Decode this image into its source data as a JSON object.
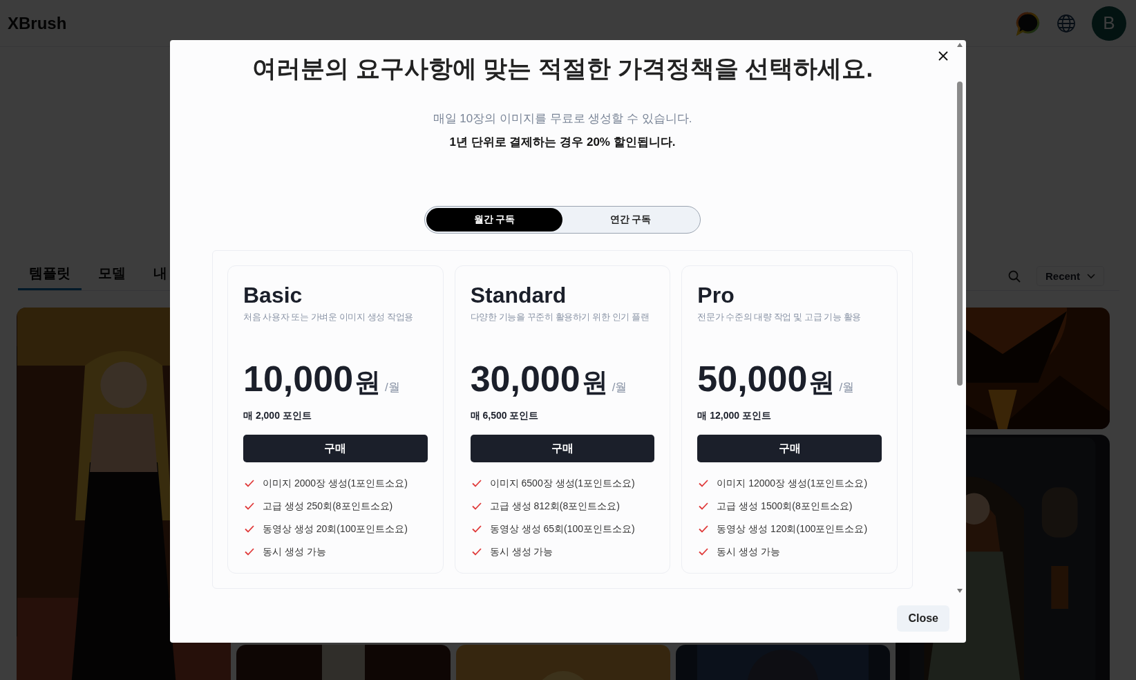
{
  "header": {
    "logo": "XBrush",
    "avatar": "B"
  },
  "tabs": [
    {
      "label": "템플릿",
      "selected": true
    },
    {
      "label": "모델",
      "selected": false
    },
    {
      "label": "내",
      "selected": false
    }
  ],
  "sort": {
    "label": "Recent"
  },
  "modal": {
    "title": "여러분의 요구사항에 맞는 적절한 가격정책을 선택하세요.",
    "subtitle": "매일 10장의 이미지를 무료로 생성할 수 있습니다.",
    "discount_note": "1년 단위로 결제하는 경우 20% 할인됩니다.",
    "billing_options": [
      {
        "label": "월간 구독",
        "selected": true
      },
      {
        "label": "연간 구독",
        "selected": false
      }
    ],
    "plans": [
      {
        "name": "Basic",
        "description": "처음 사용자 또는 가벼운 이미지 생성 작업용",
        "price": "10,000",
        "currency": "원",
        "period": "/월",
        "points": "매 2,000 포인트",
        "button": "구매",
        "features": [
          "이미지 2000장 생성(1포인트소요)",
          "고급 생성 250회(8포인트소요)",
          "동영상 생성 20회(100포인트소요)",
          "동시 생성 가능"
        ]
      },
      {
        "name": "Standard",
        "description": "다양한 기능을 꾸준히 활용하기 위한 인기 플랜",
        "price": "30,000",
        "currency": "원",
        "period": "/월",
        "points": "매 6,500 포인트",
        "button": "구매",
        "features": [
          "이미지 6500장 생성(1포인트소요)",
          "고급 생성 812회(8포인트소요)",
          "동영상 생성 65회(100포인트소요)",
          "동시 생성 가능"
        ]
      },
      {
        "name": "Pro",
        "description": "전문가 수준의 대량 작업 및 고급 기능 활용",
        "price": "50,000",
        "currency": "원",
        "period": "/월",
        "points": "매 12,000 포인트",
        "button": "구매",
        "features": [
          "이미지 12000장 생성(1포인트소요)",
          "고급 생성 1500회(8포인트소요)",
          "동영상 생성 120회(100포인트소요)",
          "동시 생성 가능"
        ]
      }
    ],
    "close_button": "Close"
  }
}
